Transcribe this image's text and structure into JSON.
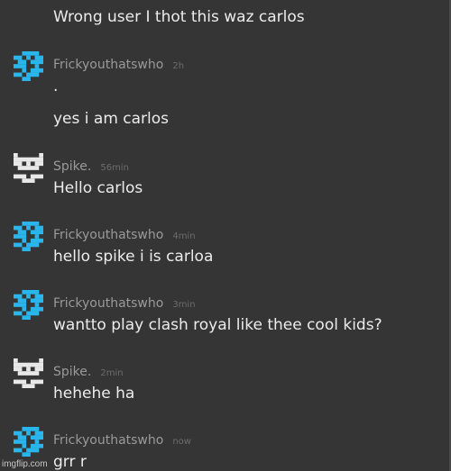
{
  "top_message": {
    "text": "Wrong user I thot this waz carlos"
  },
  "colors": {
    "background": "#353535",
    "text": "#ececec",
    "username": "#9a9a9a",
    "timestamp": "#6c6c6c",
    "avatar_blue": "#29b6ec",
    "avatar_white": "#e8e8e8"
  },
  "messages": [
    {
      "username": "Frickyouthatswho",
      "time": "2h",
      "avatar": "blue-pixel-avatar",
      "lines": [
        ".",
        "yes i am carlos"
      ]
    },
    {
      "username": "Spike.",
      "time": "56min",
      "avatar": "white-pixel-avatar",
      "lines": [
        "Hello carlos"
      ]
    },
    {
      "username": "Frickyouthatswho",
      "time": "4min",
      "avatar": "blue-pixel-avatar",
      "lines": [
        "hello spike i is carloa"
      ]
    },
    {
      "username": "Frickyouthatswho",
      "time": "3min",
      "avatar": "blue-pixel-avatar",
      "lines": [
        "wantto play clash royal like thee cool kids?"
      ]
    },
    {
      "username": "Spike.",
      "time": "2min",
      "avatar": "white-pixel-avatar",
      "lines": [
        "hehehe ha"
      ]
    },
    {
      "username": "Frickyouthatswho",
      "time": "now",
      "avatar": "blue-pixel-avatar",
      "lines": [
        "grr r"
      ]
    }
  ],
  "watermark": "imgflip.com"
}
